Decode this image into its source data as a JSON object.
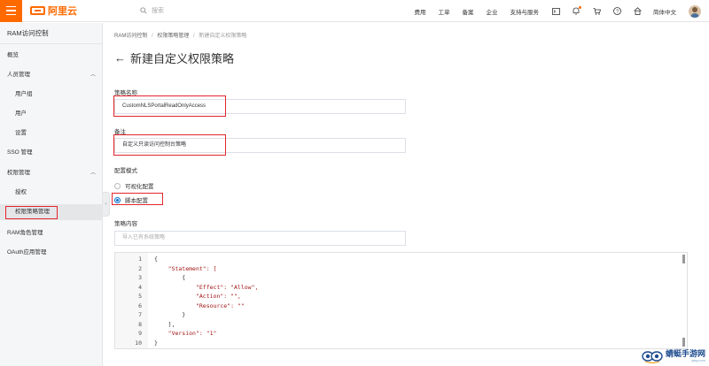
{
  "header": {
    "logo_text": "阿里云",
    "search_placeholder": "搜索",
    "nav_links": [
      "费用",
      "工单",
      "备案",
      "企业",
      "支持与服务"
    ],
    "language": "简体中文",
    "icons": [
      "terminal-icon",
      "bell-icon",
      "cart-icon",
      "help-icon",
      "home-icon"
    ]
  },
  "sidebar": {
    "title": "RAM访问控制",
    "items": [
      {
        "label": "概览",
        "level": 1
      },
      {
        "label": "人员管理",
        "level": 1,
        "expanded": true
      },
      {
        "label": "用户组",
        "level": 2
      },
      {
        "label": "用户",
        "level": 2
      },
      {
        "label": "设置",
        "level": 2
      },
      {
        "label": "SSO 管理",
        "level": 1
      },
      {
        "label": "权限管理",
        "level": 1,
        "expanded": true
      },
      {
        "label": "授权",
        "level": 2
      },
      {
        "label": "权限策略管理",
        "level": 2,
        "active": true
      },
      {
        "label": "RAM角色管理",
        "level": 1
      },
      {
        "label": "OAuth应用管理",
        "level": 1
      }
    ]
  },
  "breadcrumb": {
    "items": [
      "RAM访问控制",
      "权限策略管理",
      "新建自定义权限策略"
    ],
    "separator": "/"
  },
  "page": {
    "title": "新建自定义权限策略",
    "back_arrow": "←"
  },
  "form": {
    "policy_name_label": "策略名称",
    "policy_name_value": "CustomNLSPortalReadOnlyAccess",
    "remark_label": "备注",
    "remark_value": "自定义只读访问控制台策略",
    "mode_label": "配置模式",
    "mode_options": [
      {
        "label": "可视化配置",
        "selected": false
      },
      {
        "label": "脚本配置",
        "selected": true
      }
    ],
    "content_label": "策略内容",
    "import_placeholder": "导入已有系统策略"
  },
  "editor": {
    "lines": [
      {
        "n": "1",
        "text": "{"
      },
      {
        "n": "2",
        "text": "    \"Statement\": ["
      },
      {
        "n": "3",
        "text": "        {"
      },
      {
        "n": "4",
        "text": "            \"Effect\": \"Allow\","
      },
      {
        "n": "5",
        "text": "            \"Action\": \"\","
      },
      {
        "n": "6",
        "text": "            \"Resource\": \"\""
      },
      {
        "n": "7",
        "text": "        }"
      },
      {
        "n": "8",
        "text": "    ],"
      },
      {
        "n": "9",
        "text": "    \"Version\": \"1\""
      },
      {
        "n": "10",
        "text": "}"
      }
    ]
  },
  "watermark": {
    "text": "蜻蜓手游网",
    "sub": "qtsy.com"
  },
  "colors": {
    "brand": "#ff6a00",
    "annotation_red": "#e3262b",
    "radio_blue": "#0070cc"
  }
}
